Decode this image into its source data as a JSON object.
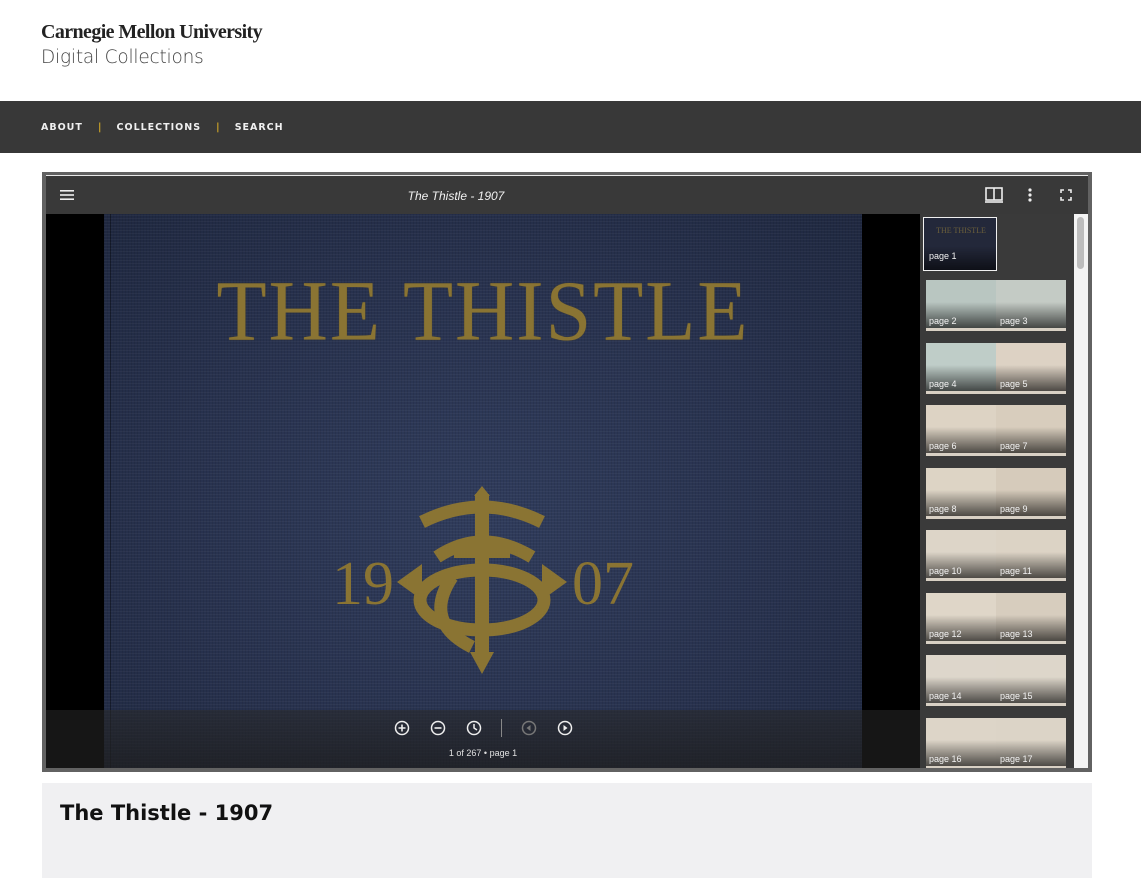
{
  "site": {
    "university": "Carnegie Mellon University",
    "subtitle": "Digital Collections"
  },
  "nav": {
    "items": [
      {
        "label": "ABOUT"
      },
      {
        "label": "COLLECTIONS"
      },
      {
        "label": "SEARCH"
      }
    ],
    "separator": "|",
    "separator_color": "#c9a227"
  },
  "viewer": {
    "title": "The Thistle - 1907",
    "toolbar_icons": [
      "menu-icon",
      "two-page-view-icon",
      "more-vert-icon",
      "fullscreen-icon"
    ],
    "cover": {
      "title_text": "THE THISTLE",
      "year_left": "19",
      "year_right": "07"
    },
    "controls": {
      "icons": [
        "zoom-in-icon",
        "zoom-out-icon",
        "reset-zoom-icon",
        "previous-page-icon",
        "next-page-icon"
      ],
      "page_readout": "1 of 267 • page 1"
    },
    "thumbnails": {
      "first": {
        "label": "page 1"
      },
      "spreads": [
        {
          "left": "page 2",
          "right": "page 3",
          "left_color": "#b9c6c1",
          "right_color": "#c4cbc5"
        },
        {
          "left": "page 4",
          "right": "page 5",
          "left_color": "#bfcdc8",
          "right_color": "#ddd2c4"
        },
        {
          "left": "page 6",
          "right": "page 7",
          "left_color": "#ddd3c4",
          "right_color": "#d8cdbd"
        },
        {
          "left": "page 8",
          "right": "page 9",
          "left_color": "#ddd4c5",
          "right_color": "#d6cbbb"
        },
        {
          "left": "page 10",
          "right": "page 11",
          "left_color": "#ddd5c8",
          "right_color": "#dcd3c5"
        },
        {
          "left": "page 12",
          "right": "page 13",
          "left_color": "#dfd6c8",
          "right_color": "#d7cdbe"
        },
        {
          "left": "page 14",
          "right": "page 15",
          "left_color": "#ddd6cb",
          "right_color": "#ddd6ca"
        },
        {
          "left": "page 16",
          "right": "page 17",
          "left_color": "#ddd5c8",
          "right_color": "#dcd4c7"
        }
      ]
    }
  },
  "info": {
    "title": "The Thistle - 1907"
  }
}
